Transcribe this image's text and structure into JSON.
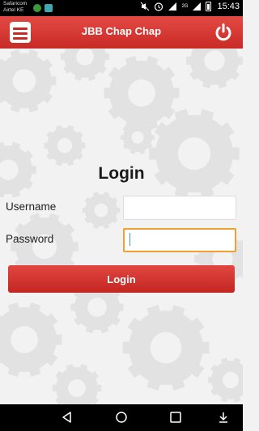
{
  "status_bar": {
    "carrier_line1": "Safaricom",
    "carrier_line2": "Airtel KE",
    "network_label": "2G",
    "time": "15:43"
  },
  "app_bar": {
    "title": "JBB Chap Chap",
    "menu_icon": "menu-icon",
    "power_icon": "power-icon"
  },
  "login": {
    "title": "Login",
    "username_label": "Username",
    "username_value": "",
    "password_label": "Password",
    "password_value": "",
    "button_label": "Login"
  },
  "colors": {
    "primary": "#d0312c",
    "focus_border": "#f0a030",
    "background": "#f2f2f2"
  },
  "nav_bar": {
    "back_icon": "back-icon",
    "home_icon": "home-icon",
    "recents_icon": "recents-icon",
    "download_icon": "download-icon"
  }
}
